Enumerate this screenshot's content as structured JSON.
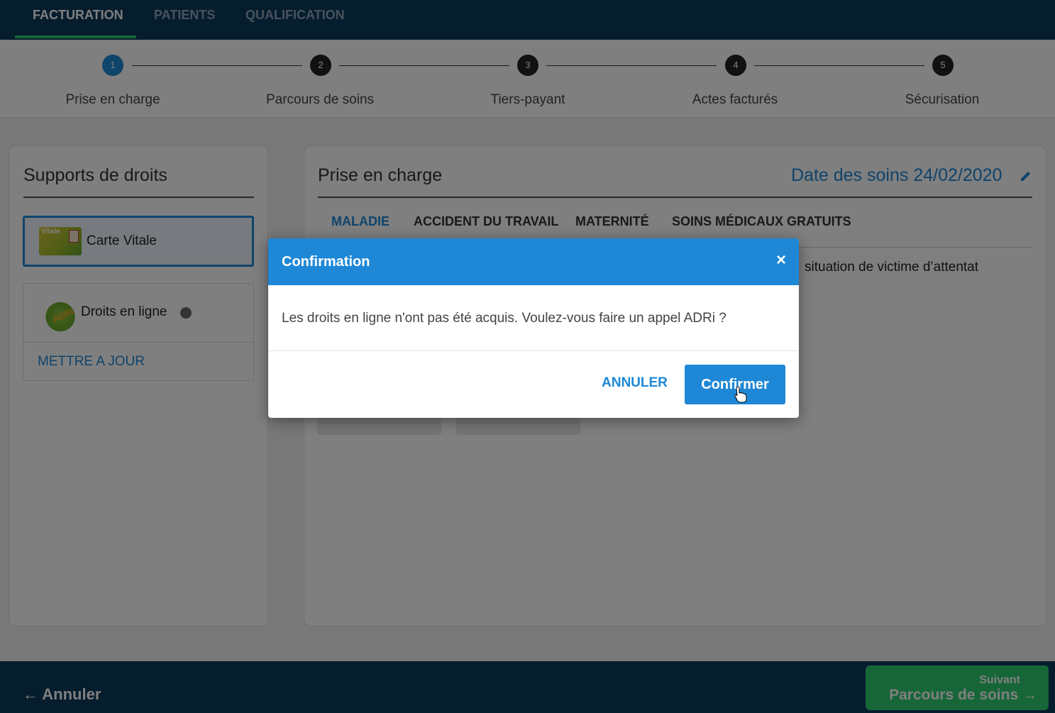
{
  "topnav": {
    "tabs": [
      {
        "label": "FACTURATION",
        "active": true
      },
      {
        "label": "PATIENTS",
        "active": false
      },
      {
        "label": "QUALIFICATION",
        "active": false
      }
    ]
  },
  "stepper": {
    "steps": [
      {
        "number": "1",
        "label": "Prise en charge",
        "active": true
      },
      {
        "number": "2",
        "label": "Parcours de soins",
        "active": false
      },
      {
        "number": "3",
        "label": "Tiers-payant",
        "active": false
      },
      {
        "number": "4",
        "label": "Actes facturés",
        "active": false
      },
      {
        "number": "5",
        "label": "Sécurisation",
        "active": false
      }
    ]
  },
  "supports": {
    "title": "Supports de droits",
    "carte_vitale": {
      "label": "Carte Vitale",
      "icon_text": "Vitale"
    },
    "droits_en_ligne": {
      "label": "Droits en ligne",
      "icon_text": "ADRi",
      "update_label": "METTRE A JOUR"
    }
  },
  "prise_en_charge": {
    "title": "Prise en charge",
    "date_label": "Date des soins 24/02/2020",
    "tabs": [
      "MALADIE",
      "ACCIDENT DU TRAVAIL",
      "MATERNITÉ",
      "SOINS MÉDICAUX GRATUITS"
    ],
    "partial_text": "situation de victime d’attentat"
  },
  "footer": {
    "cancel_label": "Annuler",
    "next_small": "Suivant",
    "next_big": "Parcours de soins"
  },
  "modal": {
    "title": "Confirmation",
    "close": "×",
    "message": "Les droits en ligne n'ont pas été acquis. Voulez-vous faire un appel ADRi ?",
    "cancel_label": "ANNULER",
    "confirm_label": "Confirmer"
  },
  "colors": {
    "primary": "#1e88d6",
    "navbar": "#0d3a5c",
    "accent": "#2ecc71"
  }
}
